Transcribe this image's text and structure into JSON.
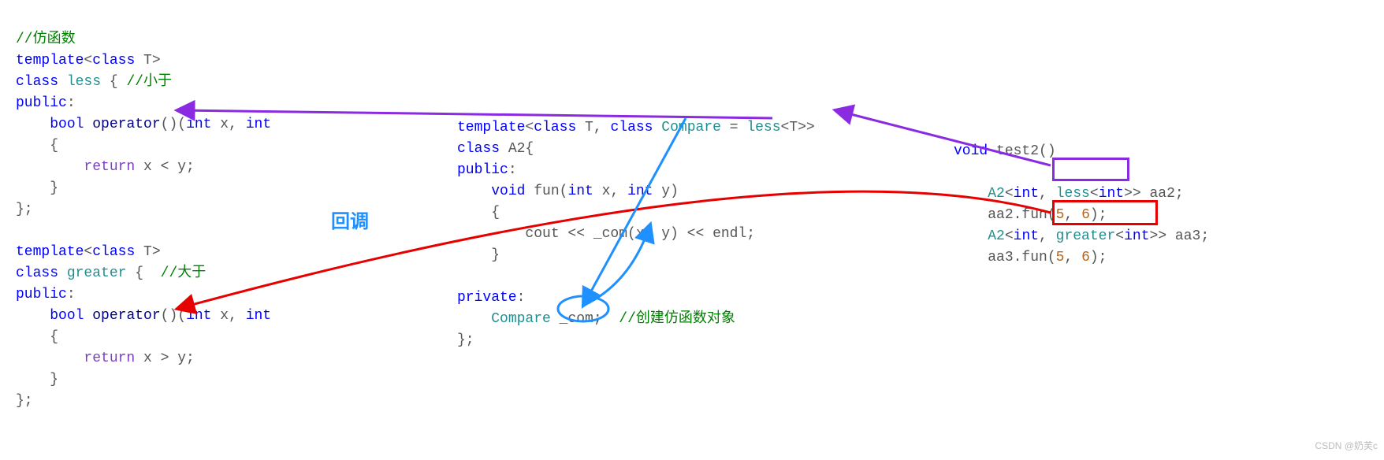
{
  "left_block": {
    "l1_comment": "//仿函数",
    "l2_template": "template",
    "l2_class": "class",
    "l2_T": " T>",
    "l3_class": "class",
    "l3_less": "less",
    "l3_open": " { ",
    "l3_comment": "//小于",
    "l4_public": "public",
    "l4_colon": ":",
    "l5_bool": "bool",
    "l5_op": " operator",
    "l5_paren": "()(",
    "l5_int": "int",
    "l5_x": " x, ",
    "l5_int2": "int",
    "l6_b": "    {",
    "l7_return": "return",
    "l7_body": " x < y;",
    "l8_b": "    }",
    "l9_end": "};",
    "g1_template": "template",
    "g1_class": "class",
    "g1_T": " T>",
    "g2_class": "class",
    "g2_greater": "greater",
    "g2_open": " {  ",
    "g2_comment": "//大于",
    "g3_public": "public",
    "g3_colon": ":",
    "g4_bool": "bool",
    "g4_op": " operator",
    "g4_paren": "()(",
    "g4_int": "int",
    "g4_x": " x, ",
    "g4_int2": "int",
    "g5_b": "    {",
    "g6_return": "return",
    "g6_body": " x > y;",
    "g7_b": "    }",
    "g8_end": "};"
  },
  "mid_block": {
    "m1_template": "template",
    "m1_lt": "<",
    "m1_class1": "class",
    "m1_T": " T, ",
    "m1_class2": "class",
    "m1_Compare": " Compare",
    "m1_eq": " = ",
    "m1_less": "less",
    "m1_lt2": "<T>>",
    "m2_class": "class",
    "m2_A2": " A2{",
    "m3_public": "public",
    "m3_colon": ":",
    "m4_void": "void",
    "m4_fun": " fun(",
    "m4_int": "int",
    "m4_x": " x, ",
    "m4_int2": "int",
    "m4_y": " y)",
    "m5_b": "    {",
    "m6_cout": "        cout << ",
    "m6_com": "_com",
    "m6_args": "(x, y) << endl;",
    "m7_b": "    }",
    "m8_private": "private",
    "m8_colon": ":",
    "m9_Compare": "Compare",
    "m9_com": " _com",
    "m9_semi": ";  ",
    "m9_comment": "//创建仿函数对象",
    "m10_end": "};"
  },
  "right_block": {
    "r1_void": "void",
    "r1_fn": " test2()",
    "r2_A2": "A2",
    "r2_lt": "<",
    "r2_int": "int",
    "r2_c": ", ",
    "r2_less": "less",
    "r2_lt2": "<",
    "r2_int2": "int",
    "r2_gt": ">",
    "r2_gt2": "> aa2;",
    "r3_call": "aa2.fun(",
    "r3_5": "5",
    "r3_c": ", ",
    "r3_6": "6",
    "r3_e": ");",
    "r4_A2": "A2",
    "r4_lt": "<",
    "r4_int": "int",
    "r4_c": ", ",
    "r4_greater": "greater",
    "r4_lt2": "<",
    "r4_int2": "int",
    "r4_gt": ">",
    "r4_gt2": "> aa3;",
    "r5_call": "aa3.fun(",
    "r5_5": "5",
    "r5_c": ", ",
    "r5_6": "6",
    "r5_e": ");"
  },
  "annotation": {
    "callback": "回调"
  },
  "watermark": "CSDN @奶芙c"
}
